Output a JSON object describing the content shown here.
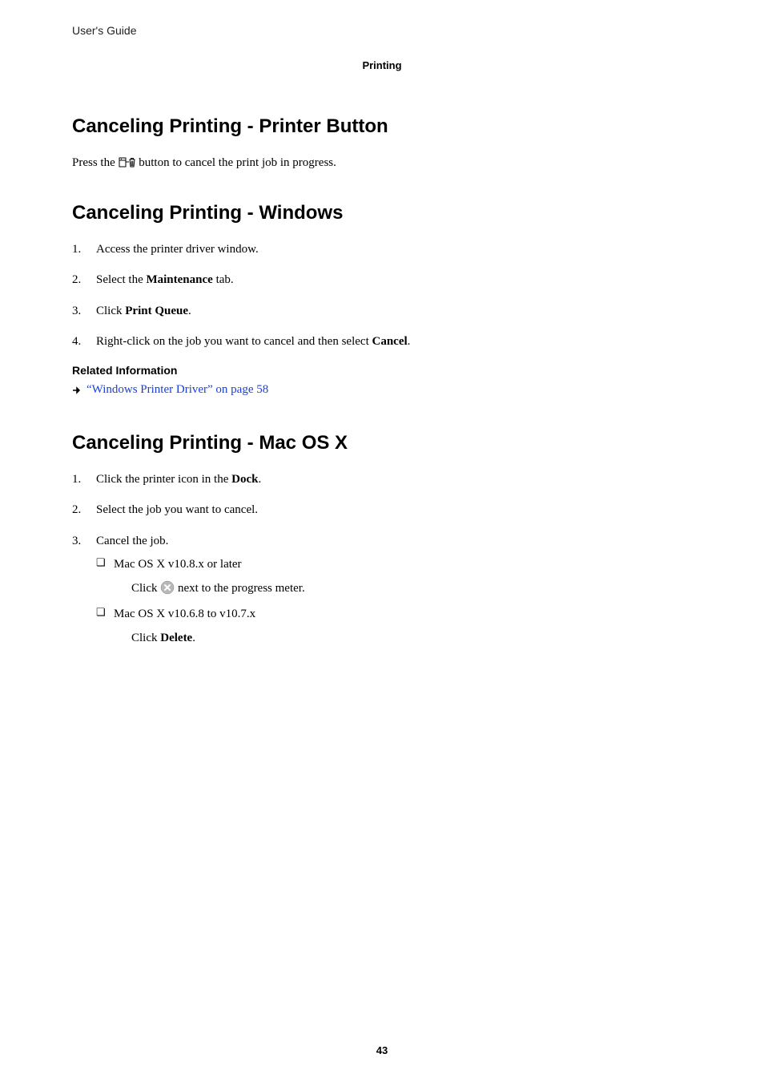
{
  "header": {
    "guide_label": "User's Guide",
    "section_label": "Printing"
  },
  "sections": {
    "printer_button": {
      "title": "Canceling Printing - Printer Button",
      "body_pre": "Press the ",
      "body_post": " button to cancel the print job in progress."
    },
    "windows": {
      "title": "Canceling Printing - Windows",
      "steps": {
        "s1": "Access the printer driver window.",
        "s2_pre": "Select the ",
        "s2_bold": "Maintenance",
        "s2_post": " tab.",
        "s3_pre": "Click ",
        "s3_bold": "Print Queue",
        "s3_post": ".",
        "s4_pre": "Right-click on the job you want to cancel and then select ",
        "s4_bold": "Cancel",
        "s4_post": "."
      },
      "related_heading": "Related Information",
      "related_link": "“Windows Printer Driver” on page 58"
    },
    "mac": {
      "title": "Canceling Printing - Mac OS X",
      "steps": {
        "s1_pre": "Click the printer icon in the ",
        "s1_bold": "Dock",
        "s1_post": ".",
        "s2": "Select the job you want to cancel.",
        "s3": "Cancel the job.",
        "sub1_label": "Mac OS X v10.8.x or later",
        "sub1_body_pre": "Click ",
        "sub1_body_post": " next to the progress meter.",
        "sub2_label": "Mac OS X v10.6.8 to v10.7.x",
        "sub2_body_pre": "Click ",
        "sub2_body_bold": "Delete",
        "sub2_body_post": "."
      }
    }
  },
  "page_number": "43"
}
